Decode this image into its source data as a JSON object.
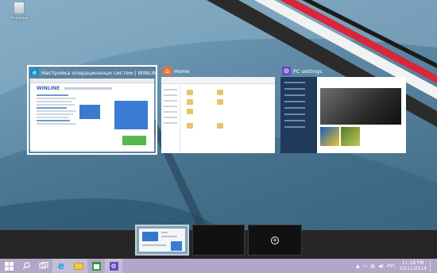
{
  "desktop": {
    "recycle_bin_label": "Корзина"
  },
  "windows": [
    {
      "title": "Настройка операционных систем | WINLINE.RU",
      "app": "Internet Explorer",
      "site_logo": "WINLINE",
      "icon": "ie-icon",
      "accent": "#1b8dd0"
    },
    {
      "title": "Home",
      "app": "File Explorer",
      "icon": "home-folder-icon",
      "accent": "#e2753b"
    },
    {
      "title": "PC settings",
      "app": "PC settings",
      "icon": "gear-icon",
      "accent": "#6a4bc2"
    }
  ],
  "taskbar": {
    "pinned": [
      {
        "name": "start-button",
        "icon": "windows-icon"
      },
      {
        "name": "search-button",
        "icon": "search-icon"
      },
      {
        "name": "task-view-button",
        "icon": "task-view-icon"
      },
      {
        "name": "ie-taskbar-button",
        "icon": "ie-icon"
      },
      {
        "name": "explorer-taskbar-button",
        "icon": "folder-icon"
      },
      {
        "name": "store-taskbar-button",
        "icon": "store-icon"
      },
      {
        "name": "settings-taskbar-button",
        "icon": "gear-icon"
      }
    ],
    "language": "РУС",
    "time": "11:18 PM",
    "date": "10/11/2014"
  },
  "colors": {
    "taskbar": "#b1a7c8",
    "switcher": "#262626"
  }
}
